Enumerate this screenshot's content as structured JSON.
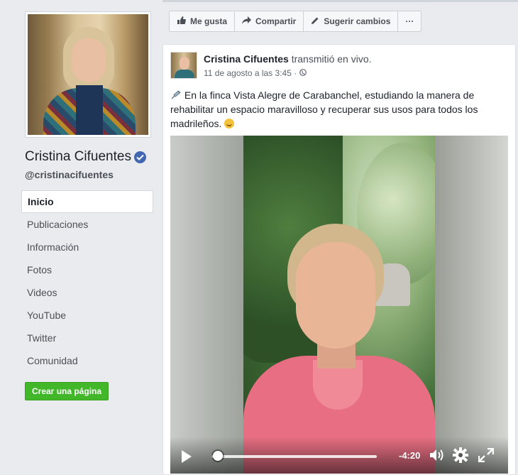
{
  "profile": {
    "name": "Cristina Cifuentes",
    "handle": "@cristinacifuentes",
    "verified": true
  },
  "nav": {
    "items": [
      {
        "label": "Inicio",
        "active": true
      },
      {
        "label": "Publicaciones"
      },
      {
        "label": "Información"
      },
      {
        "label": "Fotos"
      },
      {
        "label": "Videos"
      },
      {
        "label": "YouTube"
      },
      {
        "label": "Twitter"
      },
      {
        "label": "Comunidad"
      }
    ],
    "create_page_label": "Crear una página"
  },
  "actionbar": {
    "like_label": "Me gusta",
    "share_label": "Compartir",
    "suggest_label": "Sugerir cambios",
    "more_label": "···"
  },
  "post": {
    "author": "Cristina Cifuentes",
    "action": "transmitió en vivo.",
    "timestamp": "11 de agosto a las 3:45 ·",
    "text": "En la finca Vista Alegre de Carabanchel, estudiando la manera de rehabilitar un espacio maravilloso y recuperar sus usos para todos los madrileños.",
    "video": {
      "time_remaining": "-4:20",
      "progress_fraction": 0.04
    }
  },
  "colors": {
    "page_bg": "#e9ebee",
    "verified_blue": "#4267b2",
    "create_green": "#42b72a"
  }
}
